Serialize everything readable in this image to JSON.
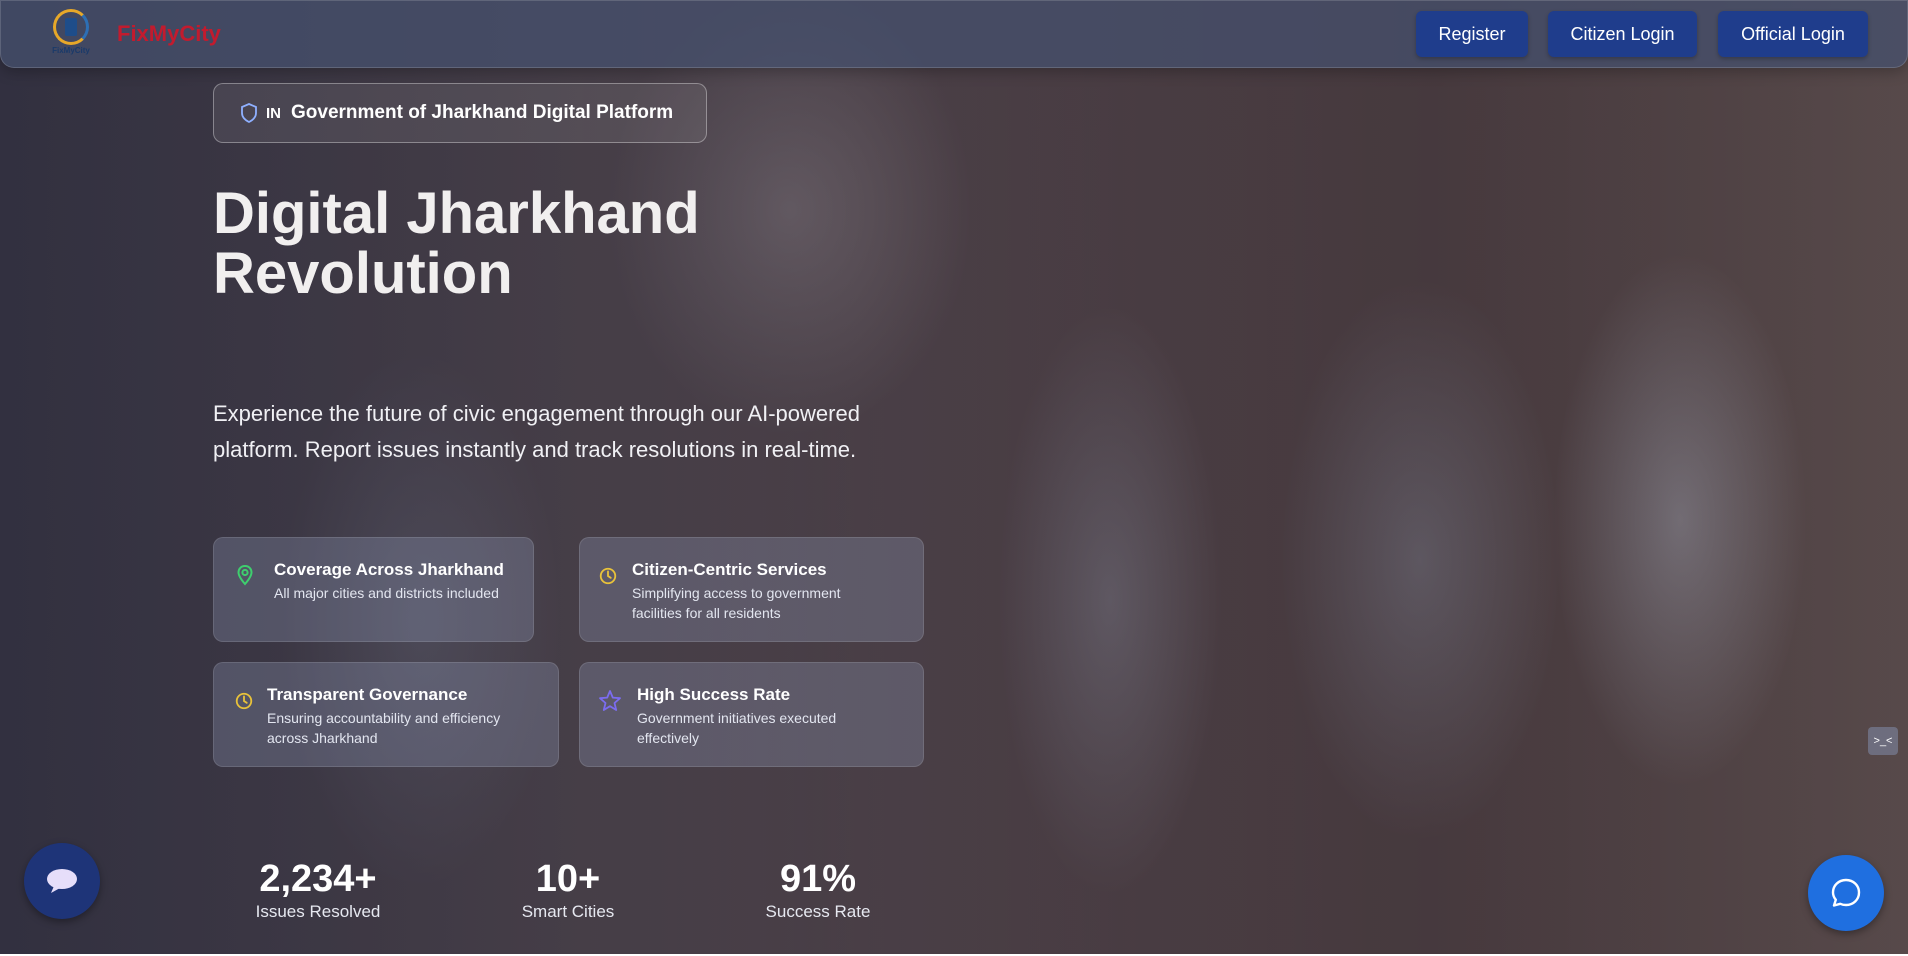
{
  "header": {
    "logo_caption": "FixMyCity",
    "brand": "FixMyCity",
    "buttons": {
      "register": "Register",
      "citizen_login": "Citizen Login",
      "official_login": "Official Login"
    }
  },
  "hero": {
    "badge_flag": "IN",
    "badge_text": "Government of Jharkhand Digital Platform",
    "title": "Digital Jharkhand Revolution",
    "subtitle": "Experience the future of civic engagement through our AI-powered platform. Report issues instantly and track resolutions in real-time."
  },
  "features": [
    {
      "icon": "map-pin-icon",
      "title": "Coverage Across Jharkhand",
      "desc": "All major cities and districts included"
    },
    {
      "icon": "clock-icon",
      "title": "Citizen-Centric Services",
      "desc": "Simplifying access to government facilities for all residents"
    },
    {
      "icon": "clock-icon",
      "title": "Transparent Governance",
      "desc": "Ensuring accountability and efficiency across Jharkhand"
    },
    {
      "icon": "star-icon",
      "title": "High Success Rate",
      "desc": "Government initiatives executed effectively"
    }
  ],
  "stats": [
    {
      "value": "2,234+",
      "label": "Issues Resolved"
    },
    {
      "value": "10+",
      "label": "Smart Cities"
    },
    {
      "value": "91%",
      "label": "Success Rate"
    }
  ],
  "side_tab": ">_<",
  "colors": {
    "brand_red": "#c21b2e",
    "nav_button": "#1f3d8c",
    "chat_left": "#1e3478",
    "chat_right": "#1f6fe0",
    "pin_green": "#3ecf6e",
    "clock_yellow": "#e8c23a",
    "star_purple": "#7b6cf0"
  }
}
